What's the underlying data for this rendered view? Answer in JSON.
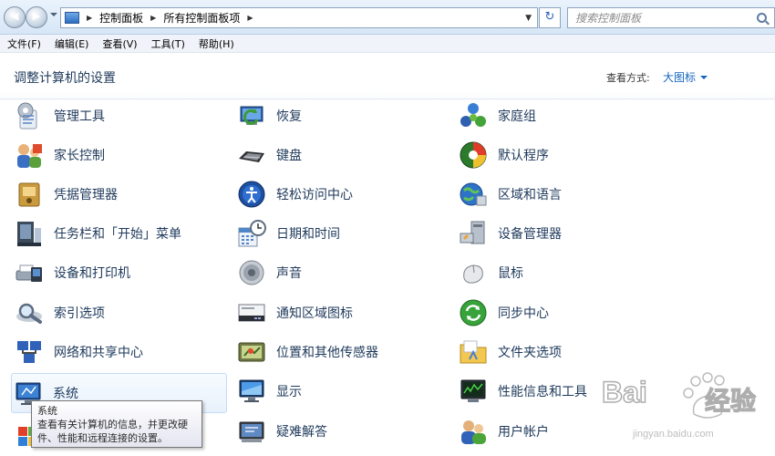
{
  "address": {
    "breadcrumbs": [
      "控制面板",
      "所有控制面板项"
    ],
    "search_placeholder": "搜索控制面板"
  },
  "menu": [
    "文件(F)",
    "编辑(E)",
    "查看(V)",
    "工具(T)",
    "帮助(H)"
  ],
  "header": {
    "title": "调整计算机的设置",
    "view_by_label": "查看方式:",
    "view_by_value": "大图标"
  },
  "items": {
    "col1": [
      "管理工具",
      "家长控制",
      "凭据管理器",
      "任务栏和「开始」菜单",
      "设备和打印机",
      "索引选项",
      "网络和共享中心",
      "系统",
      ""
    ],
    "col2": [
      "恢复",
      "键盘",
      "轻松访问中心",
      "日期和时间",
      "声音",
      "通知区域图标",
      "位置和其他传感器",
      "显示",
      "疑难解答"
    ],
    "col3": [
      "家庭组",
      "默认程序",
      "区域和语言",
      "设备管理器",
      "鼠标",
      "同步中心",
      "文件夹选项",
      "性能信息和工具",
      "用户帐户"
    ]
  },
  "tooltip": {
    "title": "系统",
    "line1": "查看有关计算机的信息，并更改硬",
    "line2": "件、性能和远程连接的设置。"
  },
  "watermark": {
    "brand": "Bai",
    "brand2": "经验",
    "url": "jingyan.baidu.com"
  }
}
